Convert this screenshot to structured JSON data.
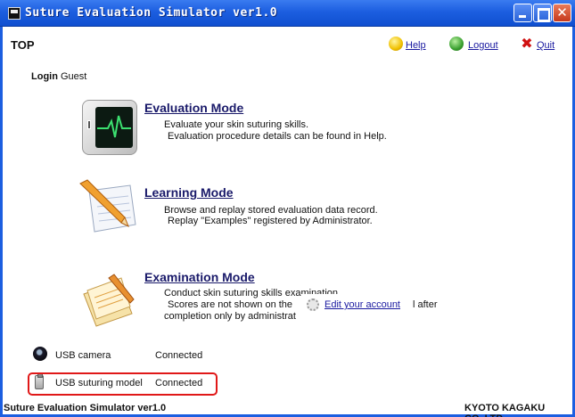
{
  "window": {
    "title": "Suture Evaluation Simulator ver1.0",
    "close_symbol": "✕"
  },
  "header": {
    "page_title": "TOP",
    "help_label": "Help",
    "logout_label": "Logout",
    "quit_label": "Quit",
    "quit_symbol": "✖"
  },
  "login": {
    "label": "Login",
    "user": "Guest"
  },
  "modes": {
    "evaluation": {
      "title": "Evaluation Mode",
      "line1": "Evaluate your skin suturing skills.",
      "line2": "Evaluation procedure details can be found in Help."
    },
    "learning": {
      "title": "Learning Mode",
      "line1": "Browse and replay stored evaluation data record.",
      "line2": "Replay \"Examples\" registered by Administrator."
    },
    "examination": {
      "title": "Examination Mode",
      "line1": "Conduct skin suturing skills examination.",
      "line2": "Scores are not shown on the",
      "line3": "completion only by administrat",
      "after_text": "l after"
    }
  },
  "edit_account": {
    "label": "Edit your account"
  },
  "status": {
    "camera_label": "USB camera",
    "camera_value": "Connected",
    "model_label": "USB suturing model",
    "model_value": "Connected"
  },
  "footer": {
    "left": "Suture Evaluation Simulator ver1.0",
    "right": "KYOTO KAGAKU CO.,LTD"
  },
  "colors": {
    "titlebar": "#1c5ee0",
    "link": "#1a1aa0",
    "highlight": "#e01818"
  },
  "icons": {
    "app": "app-icon",
    "help": "help-icon",
    "logout": "logout-icon",
    "quit": "quit-icon",
    "evaluation": "monitor-ecg-icon",
    "learning": "notepad-pencil-icon",
    "examination": "notes-pencil-icon",
    "edit_account": "gear-icon",
    "camera": "webcam-icon",
    "usb": "usb-drive-icon"
  }
}
